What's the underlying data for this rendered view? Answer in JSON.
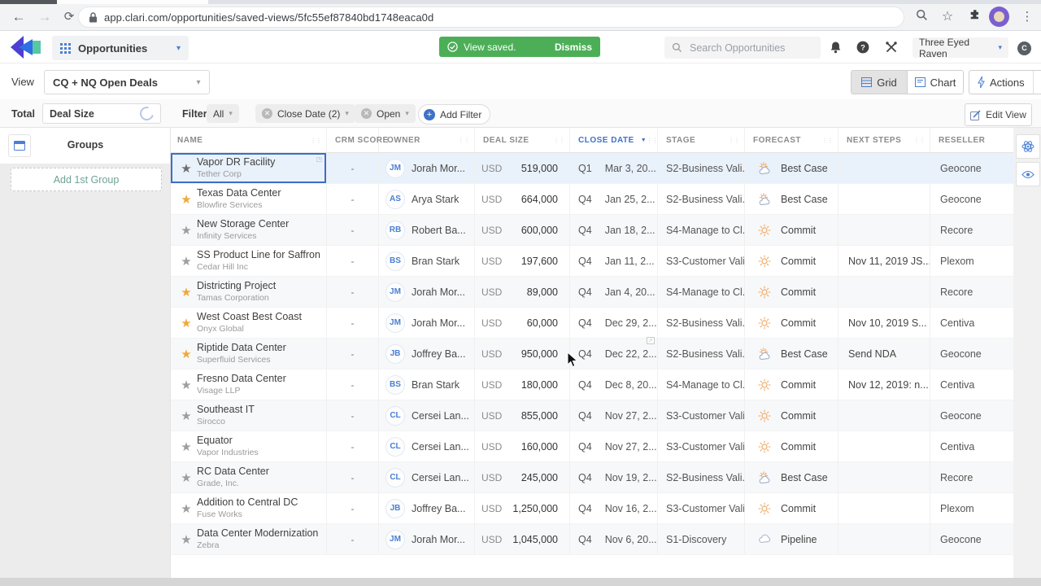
{
  "browser": {
    "url": "app.clari.com/opportunities/saved-views/5fc55ef87840bd1748eaca0d"
  },
  "header": {
    "nav_label": "Opportunities",
    "toast": {
      "message": "View saved.",
      "dismiss_label": "Dismiss"
    },
    "search_placeholder": "Search Opportunities",
    "user_name": "Three Eyed Raven"
  },
  "view_bar": {
    "view_label": "View",
    "view_value": "CQ + NQ Open Deals",
    "grid_label": "Grid",
    "chart_label": "Chart",
    "actions_label": "Actions"
  },
  "filter_bar": {
    "total_label": "Total",
    "total_value": "Deal Size",
    "filters_label": "Filters",
    "filter_all": "All",
    "filter_close_date": "Close Date (2)",
    "filter_open": "Open",
    "add_filter_label": "Add Filter",
    "edit_view_label": "Edit View"
  },
  "sidebar": {
    "title": "Groups",
    "add_group_label": "Add 1st Group"
  },
  "colors": {
    "accent": "#4a7fd4",
    "toast_green": "#4caf57",
    "star_gold": "#efa93d",
    "sort_blue": "#3f72c8"
  },
  "table": {
    "columns": [
      {
        "label": "NAME",
        "handle": true
      },
      {
        "label": "CRM SCORE",
        "handle": false
      },
      {
        "label": "OWNER",
        "handle": true
      },
      {
        "label": "DEAL SIZE",
        "handle": true
      },
      {
        "label": "CLOSE DATE",
        "handle": true,
        "sorted": "desc"
      },
      {
        "label": "STAGE",
        "handle": true
      },
      {
        "label": "FORECAST",
        "handle": true
      },
      {
        "label": "NEXT STEPS",
        "handle": true
      },
      {
        "label": "RESELLER",
        "handle": false
      }
    ],
    "rows": [
      {
        "name": "Vapor DR Facility",
        "company": "Tether Corp",
        "star": "dark",
        "crm_score": "-",
        "owner_initials": "JM",
        "owner": "Jorah Mor...",
        "currency": "USD",
        "deal_size": "519,000",
        "quarter": "Q1",
        "close_date": "Mar 3, 20...",
        "stage": "S2-Business Vali...",
        "forecast": "Best Case",
        "forecast_icon": "partly",
        "next_steps": "",
        "reseller": "Geocone",
        "selected": true
      },
      {
        "name": "Texas Data Center",
        "company": "Blowfire Services",
        "star": "gold",
        "crm_score": "-",
        "owner_initials": "AS",
        "owner": "Arya Stark",
        "currency": "USD",
        "deal_size": "664,000",
        "quarter": "Q4",
        "close_date": "Jan 25, 2...",
        "stage": "S2-Business Vali...",
        "forecast": "Best Case",
        "forecast_icon": "partly",
        "next_steps": "",
        "reseller": "Geocone"
      },
      {
        "name": "New Storage Center",
        "company": "Infinity Services",
        "star": "gray",
        "crm_score": "-",
        "owner_initials": "RB",
        "owner": "Robert Ba...",
        "currency": "USD",
        "deal_size": "600,000",
        "quarter": "Q4",
        "close_date": "Jan 18, 2...",
        "stage": "S4-Manage to Cl...",
        "forecast": "Commit",
        "forecast_icon": "sun",
        "next_steps": "",
        "reseller": "Recore"
      },
      {
        "name": "SS Product Line for Saffron",
        "company": "Cedar Hill Inc",
        "star": "gray",
        "crm_score": "-",
        "owner_initials": "BS",
        "owner": "Bran Stark",
        "currency": "USD",
        "deal_size": "197,600",
        "quarter": "Q4",
        "close_date": "Jan 11, 2...",
        "stage": "S3-Customer Vali...",
        "forecast": "Commit",
        "forecast_icon": "sun",
        "next_steps": "Nov 11, 2019 JS...",
        "reseller": "Plexom"
      },
      {
        "name": "Districting Project",
        "company": "Tamas Corporation",
        "star": "gold",
        "crm_score": "-",
        "owner_initials": "JM",
        "owner": "Jorah Mor...",
        "currency": "USD",
        "deal_size": "89,000",
        "quarter": "Q4",
        "close_date": "Jan 4, 20...",
        "stage": "S4-Manage to Cl...",
        "forecast": "Commit",
        "forecast_icon": "sun",
        "next_steps": "",
        "reseller": "Recore"
      },
      {
        "name": "West Coast Best Coast",
        "company": "Onyx Global",
        "star": "gold",
        "crm_score": "-",
        "owner_initials": "JM",
        "owner": "Jorah Mor...",
        "currency": "USD",
        "deal_size": "60,000",
        "quarter": "Q4",
        "close_date": "Dec 29, 2...",
        "stage": "S2-Business Vali...",
        "forecast": "Commit",
        "forecast_icon": "sun",
        "next_steps": "Nov 10, 2019 S...",
        "reseller": "Centiva"
      },
      {
        "name": "Riptide Data Center",
        "company": "Superfluid Services",
        "star": "gold",
        "crm_score": "-",
        "owner_initials": "JB",
        "owner": "Joffrey Ba...",
        "currency": "USD",
        "deal_size": "950,000",
        "quarter": "Q4",
        "close_date": "Dec 22, 2...",
        "stage": "S2-Business Vali...",
        "forecast": "Best Case",
        "forecast_icon": "partly",
        "next_steps": "Send NDA",
        "reseller": "Geocone"
      },
      {
        "name": "Fresno Data Center",
        "company": "Visage LLP",
        "star": "gray",
        "crm_score": "-",
        "owner_initials": "BS",
        "owner": "Bran Stark",
        "currency": "USD",
        "deal_size": "180,000",
        "quarter": "Q4",
        "close_date": "Dec 8, 20...",
        "stage": "S4-Manage to Cl...",
        "forecast": "Commit",
        "forecast_icon": "sun",
        "next_steps": "Nov 12, 2019: n...",
        "reseller": "Centiva"
      },
      {
        "name": "Southeast IT",
        "company": "Sirocco",
        "star": "gray",
        "crm_score": "-",
        "owner_initials": "CL",
        "owner": "Cersei Lan...",
        "currency": "USD",
        "deal_size": "855,000",
        "quarter": "Q4",
        "close_date": "Nov 27, 2...",
        "stage": "S3-Customer Vali...",
        "forecast": "Commit",
        "forecast_icon": "sun",
        "next_steps": "",
        "reseller": "Geocone"
      },
      {
        "name": "Equator",
        "company": "Vapor Industries",
        "star": "gray",
        "crm_score": "-",
        "owner_initials": "CL",
        "owner": "Cersei Lan...",
        "currency": "USD",
        "deal_size": "160,000",
        "quarter": "Q4",
        "close_date": "Nov 27, 2...",
        "stage": "S3-Customer Vali...",
        "forecast": "Commit",
        "forecast_icon": "sun",
        "next_steps": "",
        "reseller": "Centiva"
      },
      {
        "name": "RC Data Center",
        "company": "Grade, Inc.",
        "star": "gray",
        "crm_score": "-",
        "owner_initials": "CL",
        "owner": "Cersei Lan...",
        "currency": "USD",
        "deal_size": "245,000",
        "quarter": "Q4",
        "close_date": "Nov 19, 2...",
        "stage": "S2-Business Vali...",
        "forecast": "Best Case",
        "forecast_icon": "partly",
        "next_steps": "",
        "reseller": "Recore"
      },
      {
        "name": "Addition to Central DC",
        "company": "Fuse Works",
        "star": "gray",
        "crm_score": "-",
        "owner_initials": "JB",
        "owner": "Joffrey Ba...",
        "currency": "USD",
        "deal_size": "1,250,000",
        "quarter": "Q4",
        "close_date": "Nov 16, 2...",
        "stage": "S3-Customer Vali...",
        "forecast": "Commit",
        "forecast_icon": "sun",
        "next_steps": "",
        "reseller": "Plexom"
      },
      {
        "name": "Data Center Modernization",
        "company": "Zebra",
        "star": "gray",
        "crm_score": "-",
        "owner_initials": "JM",
        "owner": "Jorah Mor...",
        "currency": "USD",
        "deal_size": "1,045,000",
        "quarter": "Q4",
        "close_date": "Nov 6, 20...",
        "stage": "S1-Discovery",
        "forecast": "Pipeline",
        "forecast_icon": "cloud",
        "next_steps": "",
        "reseller": "Geocone"
      }
    ]
  }
}
